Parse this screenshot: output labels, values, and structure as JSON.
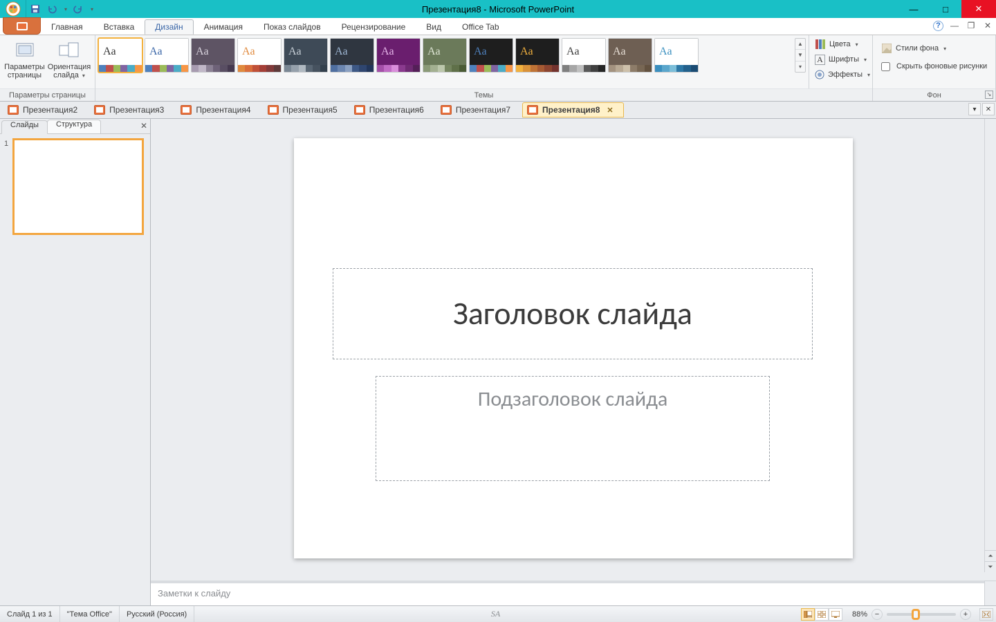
{
  "app_title": "Презентация8 - Microsoft PowerPoint",
  "ribbon_tabs": {
    "home": "Главная",
    "insert": "Вставка",
    "design": "Дизайн",
    "animation": "Анимация",
    "slideshow": "Показ слайдов",
    "review": "Рецензирование",
    "view": "Вид",
    "officetab": "Office Tab"
  },
  "ribbon_active": "design",
  "group_page": {
    "label": "Параметры страницы",
    "btn_setup": "Параметры страницы",
    "btn_orient": "Ориентация слайда"
  },
  "group_themes_label": "Темы",
  "themes_extra": {
    "colors": "Цвета",
    "fonts": "Шрифты",
    "effects": "Эффекты"
  },
  "group_bg": {
    "label": "Фон",
    "styles": "Стили фона",
    "hide": "Скрыть фоновые рисунки"
  },
  "doc_tabs": [
    "Презентация2",
    "Презентация3",
    "Презентация4",
    "Презентация5",
    "Презентация6",
    "Презентация7",
    "Презентация8"
  ],
  "doc_active_index": 6,
  "panel_tabs": {
    "slides": "Слайды",
    "outline": "Структура"
  },
  "slide": {
    "title_placeholder": "Заголовок слайда",
    "subtitle_placeholder": "Подзаголовок слайда"
  },
  "notes_placeholder": "Заметки к слайду",
  "status": {
    "slide_of": "Слайд 1 из 1",
    "theme": "\"Тема Office\"",
    "lang": "Русский (Россия)",
    "sa": "SA",
    "zoom": "88%"
  },
  "theme_thumbs": [
    {
      "bg": "#ffffff",
      "fg": "#333333",
      "sw": [
        "#4f81bd",
        "#c0504d",
        "#9bbb59",
        "#8064a2",
        "#4bacc6",
        "#f79646"
      ],
      "sel": true
    },
    {
      "bg": "#ffffff",
      "fg": "#3a66a7",
      "sw": [
        "#4f81bd",
        "#c0504d",
        "#9bbb59",
        "#8064a2",
        "#4bacc6",
        "#f79646"
      ]
    },
    {
      "bg": "#5e5464",
      "fg": "#d9d4de",
      "sw": [
        "#a79bb0",
        "#c0b7c7",
        "#8b8194",
        "#6e6278",
        "#594e63",
        "#45394f"
      ]
    },
    {
      "bg": "#ffffff",
      "fg": "#e08a3e",
      "sw": [
        "#e08a3e",
        "#d96d3b",
        "#c05038",
        "#a43f37",
        "#823a3a",
        "#5e3a3a"
      ]
    },
    {
      "bg": "#3e4a57",
      "fg": "#c8d0d8",
      "sw": [
        "#7a8794",
        "#95a0ab",
        "#b0b9c1",
        "#596673",
        "#46525f",
        "#33404d"
      ]
    },
    {
      "bg": "#2f3640",
      "fg": "#9fb7d4",
      "sw": [
        "#4f6fa0",
        "#6b86b0",
        "#8aa0c1",
        "#3d5885",
        "#2f4670",
        "#22365a"
      ]
    },
    {
      "bg": "#6a1e6e",
      "fg": "#e6b5e9",
      "sw": [
        "#a44fa8",
        "#c06bc4",
        "#d98ddb",
        "#8a3a8e",
        "#6f2a73",
        "#541f58"
      ]
    },
    {
      "bg": "#6b7a5a",
      "fg": "#dfe6d5",
      "sw": [
        "#8a9a77",
        "#a3b091",
        "#bcc7ac",
        "#74855f",
        "#5f7049",
        "#4a5b35"
      ]
    },
    {
      "bg": "#1e1e1e",
      "fg": "#4f81bd",
      "sw": [
        "#4f81bd",
        "#c0504d",
        "#9bbb59",
        "#8064a2",
        "#4bacc6",
        "#f79646"
      ]
    },
    {
      "bg": "#1e1e1e",
      "fg": "#f2b13e",
      "sw": [
        "#f2b13e",
        "#d9923a",
        "#bf7336",
        "#a65a33",
        "#8c4530",
        "#73332e"
      ]
    },
    {
      "bg": "#ffffff",
      "fg": "#3b3b3b",
      "sw": [
        "#7f7f7f",
        "#a6a6a6",
        "#bfbfbf",
        "#595959",
        "#404040",
        "#262626"
      ]
    },
    {
      "bg": "#6e5f53",
      "fg": "#e7dfd6",
      "sw": [
        "#a3927f",
        "#b8a994",
        "#cdc0aa",
        "#8d7c69",
        "#786754",
        "#635240"
      ]
    },
    {
      "bg": "#ffffff",
      "fg": "#3a8fbf",
      "sw": [
        "#3a8fbf",
        "#5aa6cc",
        "#7bbed9",
        "#2d78a6",
        "#23618c",
        "#1a4b73"
      ]
    }
  ]
}
